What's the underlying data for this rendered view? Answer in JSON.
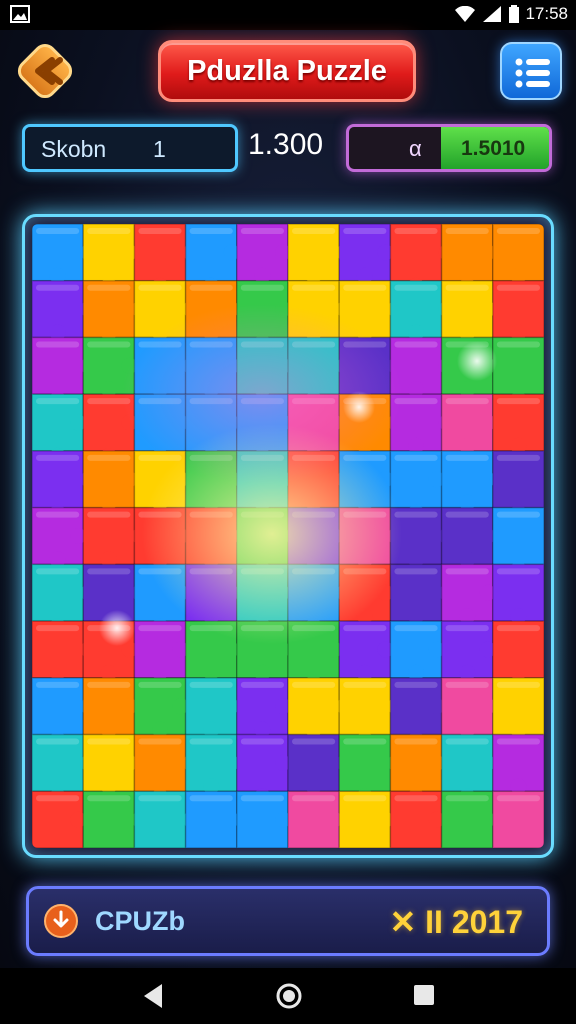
{
  "status_bar": {
    "time": "17:58"
  },
  "header": {
    "title": "Pduzlla Puzzle"
  },
  "stats": {
    "left_label": "Skobn",
    "left_value": "1",
    "center_value": "1.300",
    "right_label": "α",
    "right_value": "1.5010"
  },
  "board": {
    "rows": 11,
    "cols": 10
  },
  "bottom_bar": {
    "label": "CPUZb",
    "score": "✕ II 2017"
  },
  "icons": {
    "back": "back-arrow-icon",
    "menu": "menu-list-icon",
    "nav_back": "nav-back-icon",
    "nav_home": "nav-home-icon",
    "nav_recents": "nav-recents-icon"
  }
}
